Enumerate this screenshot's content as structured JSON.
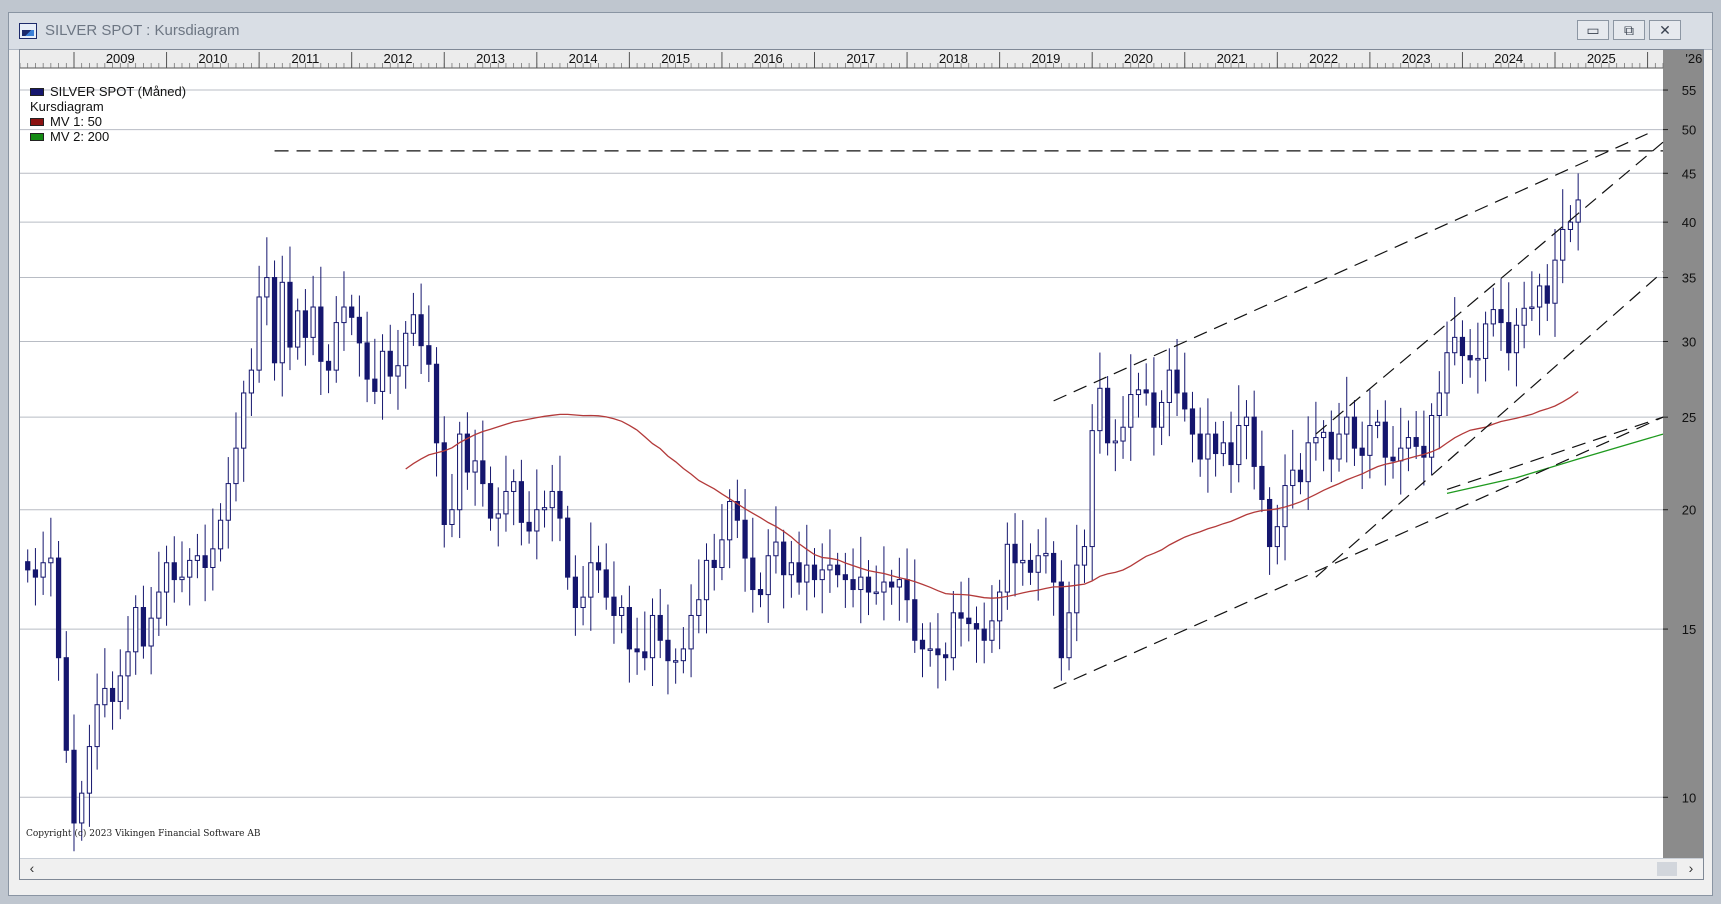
{
  "window": {
    "title": "SILVER SPOT : Kursdiagram",
    "min_label": "▭",
    "restore_label": "⧉",
    "close_label": "✕"
  },
  "legend": {
    "series_label": "SILVER SPOT (Måned)",
    "chart_label": "Kursdiagram",
    "mv1_label": "MV 1: 50",
    "mv2_label": "MV 2: 200"
  },
  "copyright": "Copyright (c) 2023 Vikingen Financial Software AB",
  "colors": {
    "candle": "#15166e",
    "mv1": "#b33a3a",
    "mv2": "#1f9a1f",
    "grid": "#b8bcc4",
    "yaxis_bg": "#8b8b8b",
    "legend_series": "#15166e",
    "legend_mv1": "#8b1111",
    "legend_mv2": "#138a13"
  },
  "chart_data": {
    "type": "candlestick",
    "title": "SILVER SPOT : Kursdiagram",
    "interval": "Måned",
    "y_scale": "log",
    "ylim": [
      9,
      58
    ],
    "y_ticks": [
      10,
      15,
      20,
      25,
      30,
      35,
      40,
      45,
      50,
      55
    ],
    "x_ticks": [
      "2009",
      "2010",
      "2011",
      "2012",
      "2013",
      "2014",
      "2015",
      "2016",
      "2017",
      "2018",
      "2019",
      "2020",
      "2021",
      "2022",
      "2023",
      "2024",
      "2025",
      "'26"
    ],
    "x_range": [
      "2008-06",
      "2026-03"
    ],
    "series": [
      {
        "name": "SILVER SPOT",
        "close": [
          17.3,
          17.0,
          17.6,
          17.8,
          14.0,
          11.2,
          9.4,
          10.1,
          11.3,
          12.5,
          13.0,
          12.6,
          13.4,
          14.2,
          15.8,
          14.4,
          15.4,
          16.4,
          17.6,
          16.9,
          17.0,
          17.7,
          17.9,
          17.4,
          18.2,
          19.5,
          21.3,
          23.2,
          26.5,
          28.0,
          33.4,
          35.0,
          28.5,
          34.6,
          29.6,
          32.3,
          30.3,
          32.6,
          28.6,
          28.0,
          31.4,
          32.6,
          31.8,
          29.9,
          27.4,
          26.6,
          29.3,
          27.6,
          28.3,
          30.6,
          32.0,
          29.7,
          28.4,
          23.5,
          19.3,
          20.0,
          24.0,
          21.9,
          22.5,
          21.3,
          19.6,
          19.8,
          20.9,
          21.4,
          19.4,
          19.0,
          20.0,
          20.1,
          20.9,
          19.6,
          17.0,
          15.8,
          16.2,
          17.6,
          17.3,
          16.2,
          15.5,
          15.8,
          14.3,
          14.2,
          14.0,
          15.5,
          14.6,
          13.9,
          13.9,
          14.3,
          15.5,
          16.1,
          17.7,
          17.4,
          18.6,
          20.4,
          19.5,
          17.8,
          16.5,
          16.3,
          17.9,
          18.5,
          17.1,
          17.6,
          16.8,
          17.5,
          16.9,
          17.3,
          17.5,
          17.1,
          16.9,
          16.5,
          17.0,
          16.4,
          16.4,
          16.8,
          16.6,
          16.9,
          16.1,
          14.6,
          14.3,
          14.3,
          14.1,
          14.0,
          15.6,
          15.4,
          15.2,
          15.0,
          14.6,
          15.3,
          16.4,
          18.4,
          17.6,
          17.7,
          17.2,
          17.9,
          18.0,
          16.8,
          14.0,
          15.6,
          17.5,
          18.3,
          24.2,
          26.8,
          23.5,
          23.6,
          24.4,
          26.4,
          26.7,
          26.5,
          24.4,
          25.9,
          28.0,
          26.5,
          25.5,
          24.0,
          22.6,
          24.0,
          22.9,
          23.5,
          22.3,
          24.5,
          25.0,
          22.2,
          20.5,
          18.3,
          19.2,
          21.2,
          22.0,
          21.4,
          23.5,
          23.8,
          24.1,
          22.6,
          24.0,
          25.0,
          23.2,
          22.8,
          24.5,
          24.7,
          22.7,
          22.5,
          23.2,
          23.8,
          23.3,
          22.7,
          25.1,
          26.5,
          29.2,
          30.3,
          29.0,
          28.7,
          28.8,
          31.3,
          32.4,
          31.4,
          29.2,
          31.2,
          32.5,
          32.6,
          34.3,
          32.9,
          36.5,
          39.3,
          40.0,
          42.2
        ],
        "open_high_low_note": "values read per monthly candle"
      },
      {
        "name": "MV 1: 50",
        "values": []
      },
      {
        "name": "MV 2: 200",
        "values": []
      }
    ],
    "trendlines": [
      "resistance 47.5 (2011-2026)",
      "channel 2020-2026",
      "channel 2022-2026"
    ],
    "grid": true,
    "legend_position": "top-left",
    "yaxis_position": "right"
  }
}
